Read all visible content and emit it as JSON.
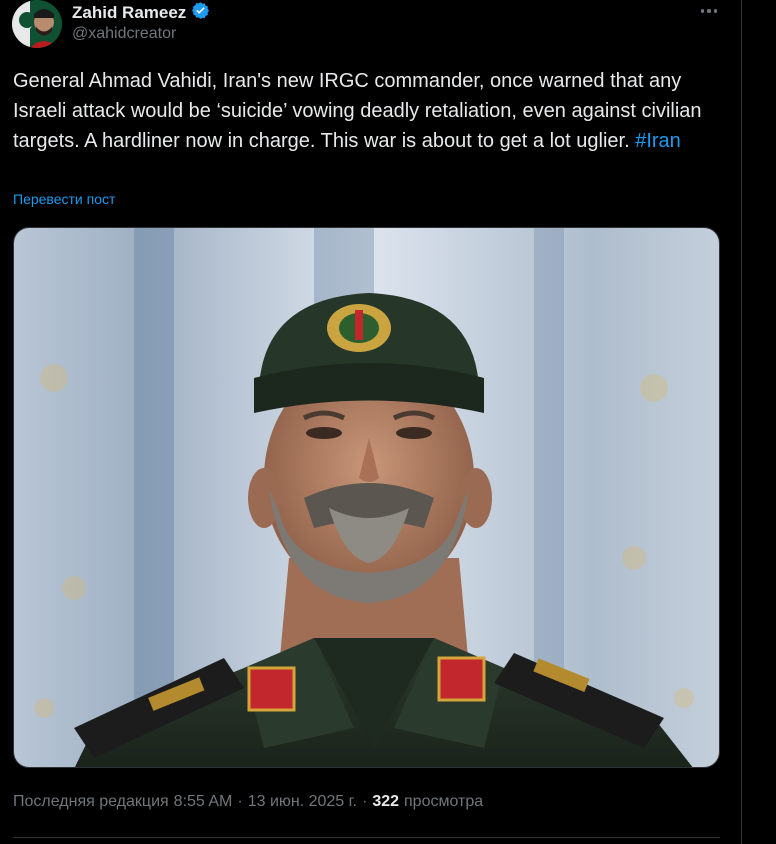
{
  "author": {
    "name": "Zahid Rameez",
    "handle": "@xahidcreator",
    "verified": true
  },
  "tweet": {
    "text": "General Ahmad Vahidi, Iran's new IRGC commander, once warned that any Israeli attack would be ‘suicide’ vowing deadly retaliation, even against civilian targets. A hardliner now in charge. This war is about to get a lot uglier. ",
    "hashtag": "#Iran",
    "translate_label": "Перевести пост"
  },
  "meta": {
    "edited_label": "Последняя редакция",
    "time": "8:55 AM",
    "separator": "·",
    "date": "13 июн. 2025 г.",
    "views_count": "322",
    "views_label": "просмотра"
  },
  "colors": {
    "background": "#000000",
    "text": "#e7e9ea",
    "secondary": "#71767b",
    "accent": "#1d9bf0",
    "border": "#2f3336"
  },
  "icons": {
    "verified": "verified-badge-icon",
    "more": "more-icon"
  }
}
